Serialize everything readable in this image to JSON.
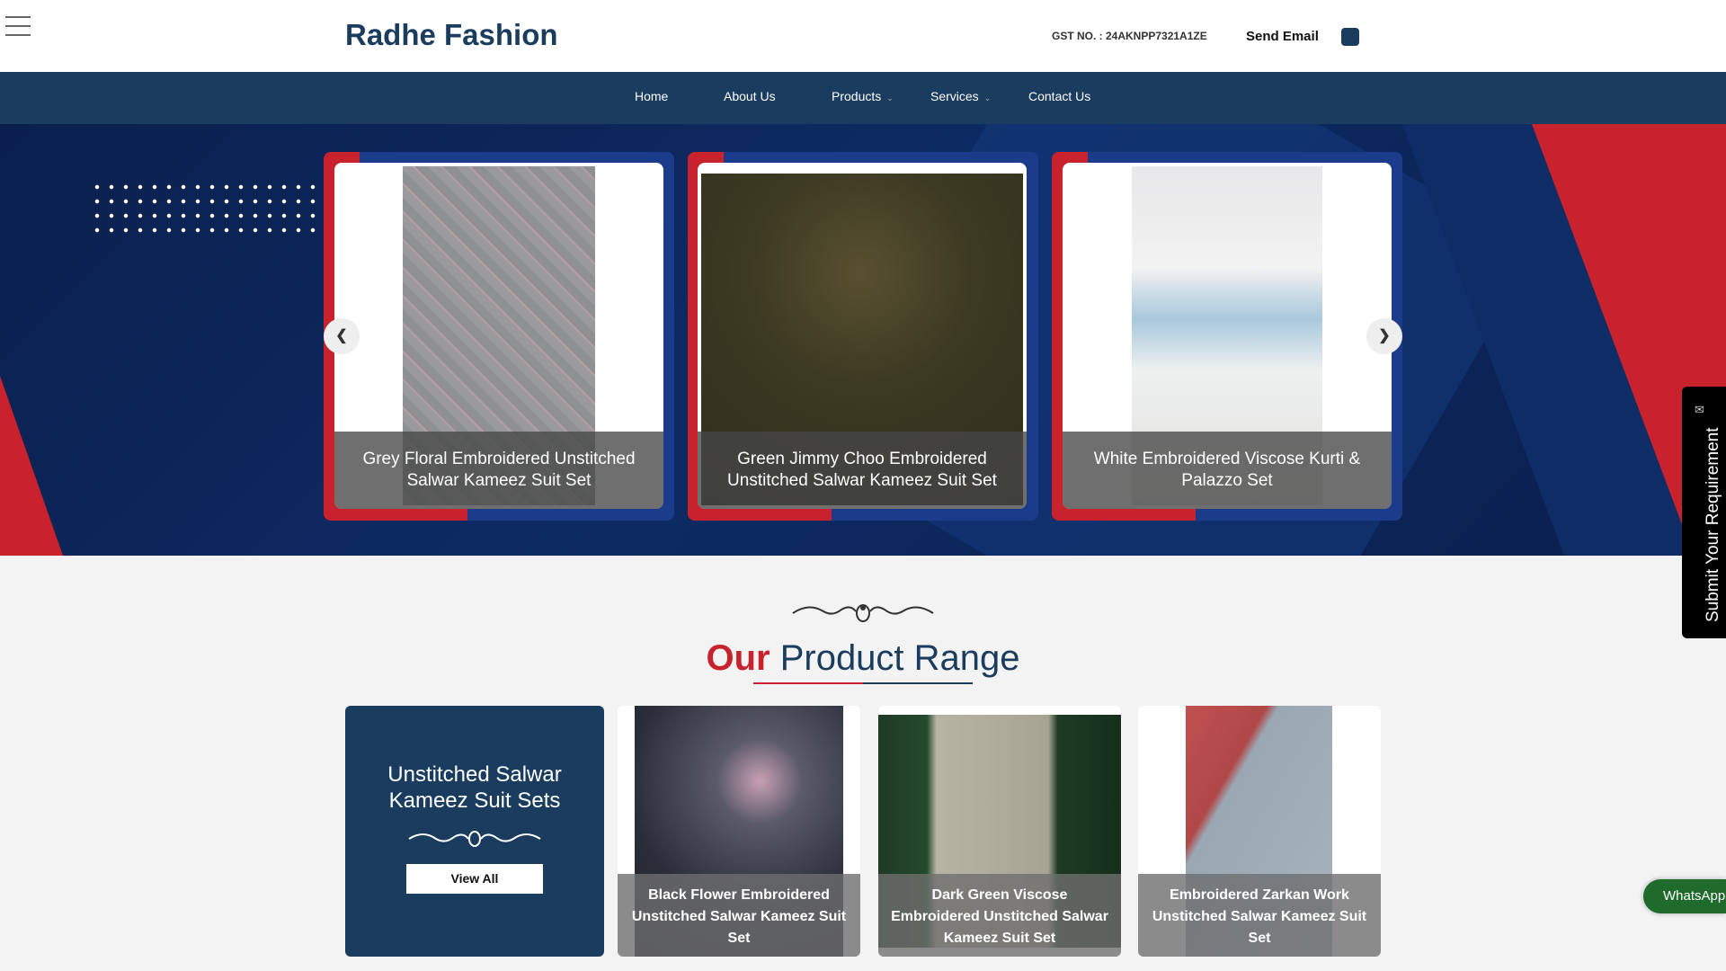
{
  "header": {
    "logo": "Radhe Fashion",
    "gst": "GST NO. : 24AKNPP7321A1ZE",
    "send_email": "Send Email"
  },
  "nav": [
    {
      "label": "Home"
    },
    {
      "label": "About Us"
    },
    {
      "label": "Products",
      "chev": "⌄"
    },
    {
      "label": "Services",
      "chev": "⌄"
    },
    {
      "label": "Contact Us"
    }
  ],
  "slider": {
    "prev": "❮",
    "next": "❯",
    "cards": [
      {
        "caption": "Grey Floral Embroidered Unstitched Salwar Kameez Suit Set"
      },
      {
        "caption": "Green Jimmy Choo Embroidered Unstitched Salwar Kameez Suit Set"
      },
      {
        "caption": "White Embroidered Viscose Kurti & Palazzo Set"
      }
    ]
  },
  "section": {
    "title_highlight": "Our",
    "title_rest": " Product Range"
  },
  "category": {
    "title": "Unstitched Salwar Kameez Suit Sets",
    "button": "View All"
  },
  "products": [
    {
      "caption": "Black Flower Embroidered Unstitched Salwar Kameez Suit Set"
    },
    {
      "caption": "Dark Green Viscose Embroidered Unstitched Salwar Kameez Suit Set"
    },
    {
      "caption": "Embroidered Zarkan Work Unstitched Salwar Kameez Suit Set"
    }
  ],
  "side": {
    "submit": "Submit Your Requirement",
    "mail_icon": "✉",
    "whatsapp": "WhatsApp"
  },
  "colors": {
    "brand": "#1a3c5e",
    "accent": "#c8232c"
  }
}
